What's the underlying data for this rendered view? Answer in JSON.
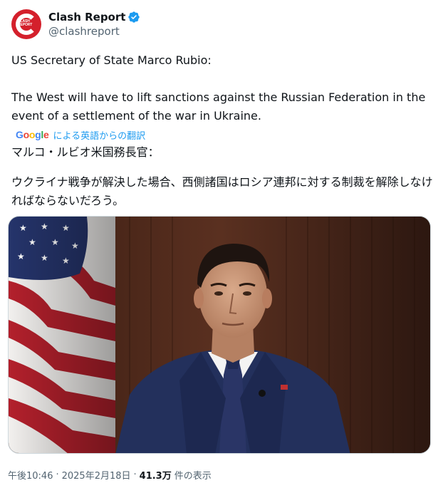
{
  "account": {
    "display_name": "Clash Report",
    "handle": "@clashreport",
    "avatar_logo_line1": "CLASH",
    "avatar_logo_line2": "REPORT",
    "brand_color": "#d4202c",
    "verified_color": "#1d9bf0"
  },
  "tweet": {
    "text_line1": "US Secretary of State Marco Rubio:",
    "text_line2": "The West will have to lift sanctions against the Russian Federation in the event of a settlement of the war in Ukraine.",
    "translate_logo": "Google",
    "translate_label": "による英語からの翻訳",
    "translated_line1": "マルコ・ルビオ米国務長官：",
    "translated_line2": "ウクライナ戦争が解決した場合、西側諸国はロシア連邦に対する制裁を解除しなければならないだろう。"
  },
  "media": {
    "type": "video-still",
    "subject": "man in suit in front of US flag"
  },
  "footer": {
    "time": "午後10:46",
    "date": "2025年2月18日",
    "views_count": "41.3万",
    "views_label": "件の表示",
    "separator": "·"
  }
}
